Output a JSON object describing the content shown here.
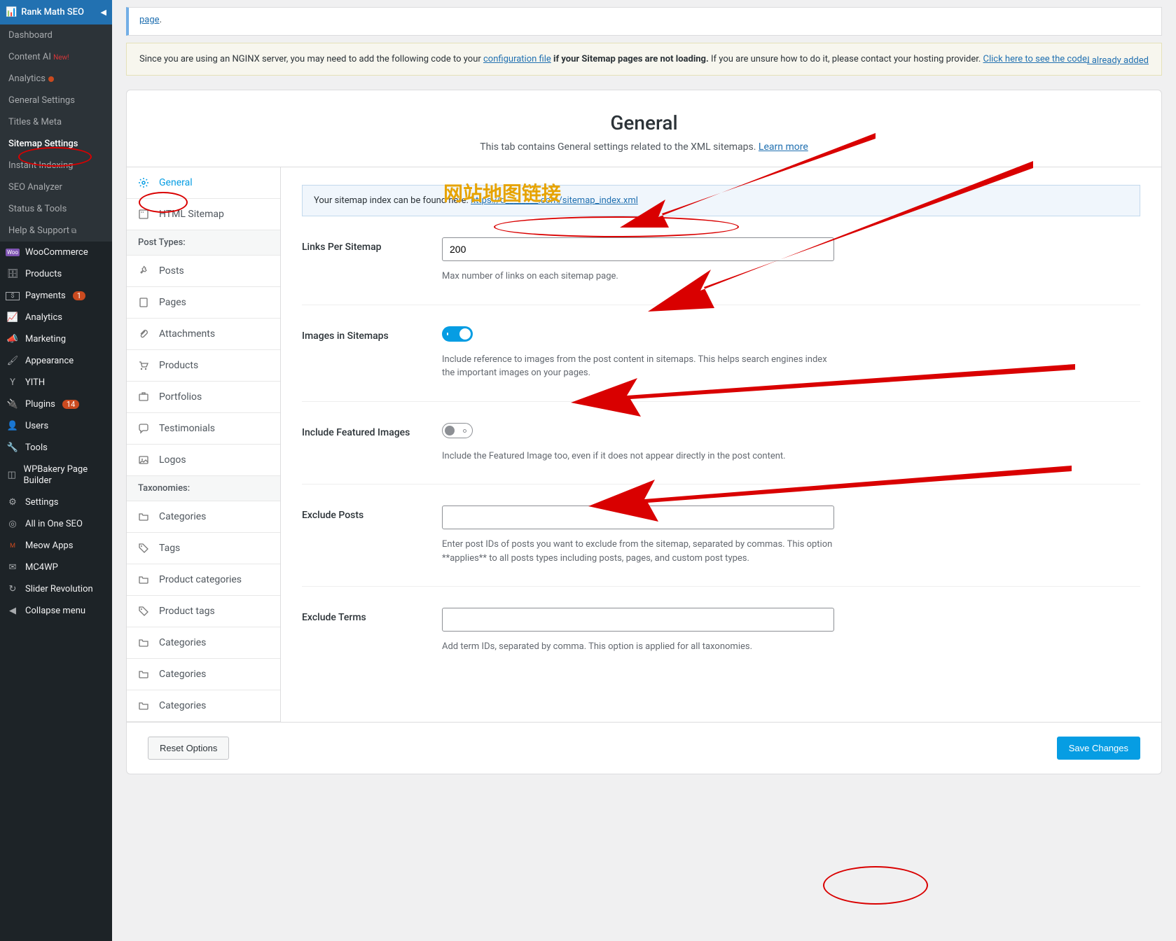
{
  "sidebar": {
    "header": "Rank Math SEO",
    "submenu": [
      {
        "label": "Dashboard"
      },
      {
        "label": "Content AI",
        "new": "New!"
      },
      {
        "label": "Analytics",
        "dot": true
      },
      {
        "label": "General Settings"
      },
      {
        "label": "Titles & Meta"
      },
      {
        "label": "Sitemap Settings",
        "active": true
      },
      {
        "label": "Instant Indexing"
      },
      {
        "label": "SEO Analyzer"
      },
      {
        "label": "Status & Tools"
      },
      {
        "label": "Help & Support",
        "ext": true
      }
    ],
    "items": [
      {
        "label": "WooCommerce",
        "icon": "woo"
      },
      {
        "label": "Products",
        "icon": "archive"
      },
      {
        "label": "Payments",
        "icon": "dollar",
        "count": "1"
      },
      {
        "label": "Analytics",
        "icon": "chart"
      },
      {
        "label": "Marketing",
        "icon": "megaphone"
      },
      {
        "label": "Appearance",
        "icon": "brush"
      },
      {
        "label": "YITH",
        "icon": "y"
      },
      {
        "label": "Plugins",
        "icon": "plug",
        "count": "14"
      },
      {
        "label": "Users",
        "icon": "user"
      },
      {
        "label": "Tools",
        "icon": "wrench"
      },
      {
        "label": "WPBakery Page Builder",
        "icon": "wpb"
      },
      {
        "label": "Settings",
        "icon": "sliders"
      },
      {
        "label": "All in One SEO",
        "icon": "aio"
      },
      {
        "label": "Meow Apps",
        "icon": "meow"
      },
      {
        "label": "MC4WP",
        "icon": "mc"
      },
      {
        "label": "Slider Revolution",
        "icon": "refresh"
      },
      {
        "label": "Collapse menu",
        "icon": "collapse"
      }
    ]
  },
  "notice_top": {
    "text": "page.",
    "link": "page"
  },
  "notice_yellow": {
    "part1": "Since you are using an NGINX server, you may need to add the following code to your ",
    "link1": "configuration file",
    "part2": " if your Sitemap pages are not loading.",
    "part3": " If you are unsure how to do it, please contact your hosting provider. ",
    "link2": "Click here to see the code.",
    "already": "I already added"
  },
  "page": {
    "title": "General",
    "subtitle": "This tab contains General settings related to the XML sitemaps. ",
    "learn_more": "Learn more"
  },
  "tabs": [
    {
      "label": "General",
      "icon": "gear",
      "active": true
    },
    {
      "label": "HTML Sitemap",
      "icon": "html"
    }
  ],
  "tab_section1": "Post Types:",
  "tabs_posts": [
    {
      "label": "Posts",
      "icon": "pin"
    },
    {
      "label": "Pages",
      "icon": "page"
    },
    {
      "label": "Attachments",
      "icon": "clip"
    },
    {
      "label": "Products",
      "icon": "cart"
    },
    {
      "label": "Portfolios",
      "icon": "portfolio"
    },
    {
      "label": "Testimonials",
      "icon": "chat"
    },
    {
      "label": "Logos",
      "icon": "image"
    }
  ],
  "tab_section2": "Taxonomies:",
  "tabs_tax": [
    {
      "label": "Categories",
      "icon": "folder"
    },
    {
      "label": "Tags",
      "icon": "tag"
    },
    {
      "label": "Product categories",
      "icon": "folder"
    },
    {
      "label": "Product tags",
      "icon": "tag"
    },
    {
      "label": "Categories",
      "icon": "folder"
    },
    {
      "label": "Categories",
      "icon": "folder"
    },
    {
      "label": "Categories",
      "icon": "folder"
    }
  ],
  "settings": {
    "sitemap_info": {
      "text": "Your sitemap index can be found here: ",
      "url": "https://d________.com/sitemap_index.xml"
    },
    "links_per": {
      "label": "Links Per Sitemap",
      "value": "200",
      "help": "Max number of links on each sitemap page."
    },
    "images": {
      "label": "Images in Sitemaps",
      "help": "Include reference to images from the post content in sitemaps. This helps search engines index the important images on your pages."
    },
    "featured": {
      "label": "Include Featured Images",
      "help": "Include the Featured Image too, even if it does not appear directly in the post content."
    },
    "exclude_posts": {
      "label": "Exclude Posts",
      "help": "Enter post IDs of posts you want to exclude from the sitemap, separated by commas. This option **applies** to all posts types including posts, pages, and custom post types."
    },
    "exclude_terms": {
      "label": "Exclude Terms",
      "help": "Add term IDs, separated by comma. This option is applied for all taxonomies."
    }
  },
  "buttons": {
    "reset": "Reset Options",
    "save": "Save Changes"
  },
  "annotation_text": "网站地图链接"
}
